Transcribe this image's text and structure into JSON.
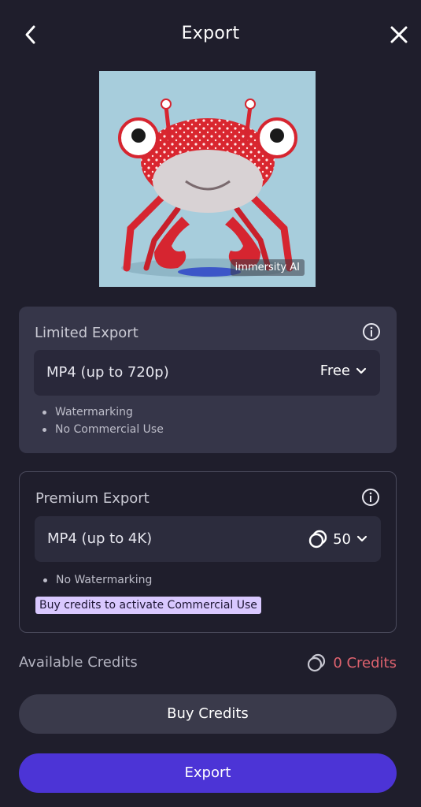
{
  "header": {
    "title": "Export"
  },
  "preview": {
    "watermark": "immersity AI"
  },
  "limited": {
    "title": "Limited Export",
    "format": "MP4 (up to 720p)",
    "price": "Free",
    "bullets": [
      "Watermarking",
      "No Commercial Use"
    ]
  },
  "premium": {
    "title": "Premium Export",
    "format": "MP4 (up to 4K)",
    "price": "50",
    "bullets": [
      "No Watermarking"
    ],
    "promo": "Buy credits to activate Commercial Use"
  },
  "credits": {
    "label": "Available Credits",
    "value": "0 Credits"
  },
  "buttons": {
    "buy": "Buy Credits",
    "export": "Export"
  },
  "colors": {
    "accent": "#4c34d6",
    "warning": "#e0636f",
    "promo": "#d9c8ff"
  }
}
